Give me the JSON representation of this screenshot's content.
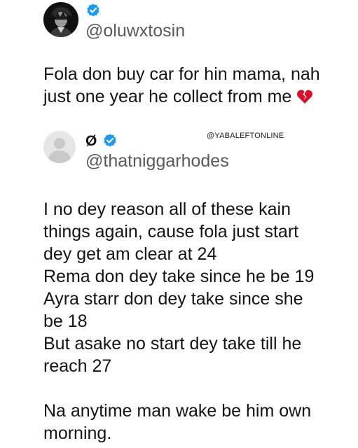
{
  "tweet1": {
    "handle": "@oluwxtosin",
    "lines": [
      "Fola don buy car for hin mama, nah",
      "just one year he collect from me"
    ],
    "emoji_icon": "broken-heart-icon",
    "avatar_icon": "anime-avatar",
    "verified_icon": "verified-badge-icon"
  },
  "watermark": "@YABALEFTONLINE",
  "tweet2": {
    "name": "Ø",
    "handle": "@thatniggarhodes",
    "avatar_icon": "default-profile-icon",
    "verified_icon": "verified-badge-icon",
    "lines": [
      "I no dey reason all of these kain",
      "things again, cause fola just start",
      "dey get am clear at 24",
      "Rema don dey take since he be 19",
      "Ayra starr don dey take since she",
      "be 18",
      "But asake no start dey take till he",
      "reach 27"
    ],
    "closing_lines": [
      "Na anytime man wake be him own",
      "morning."
    ]
  },
  "colors": {
    "verified": "#1d9bf0",
    "heart": "#d9112a",
    "handle": "#5a5a5a",
    "text": "#141414"
  }
}
